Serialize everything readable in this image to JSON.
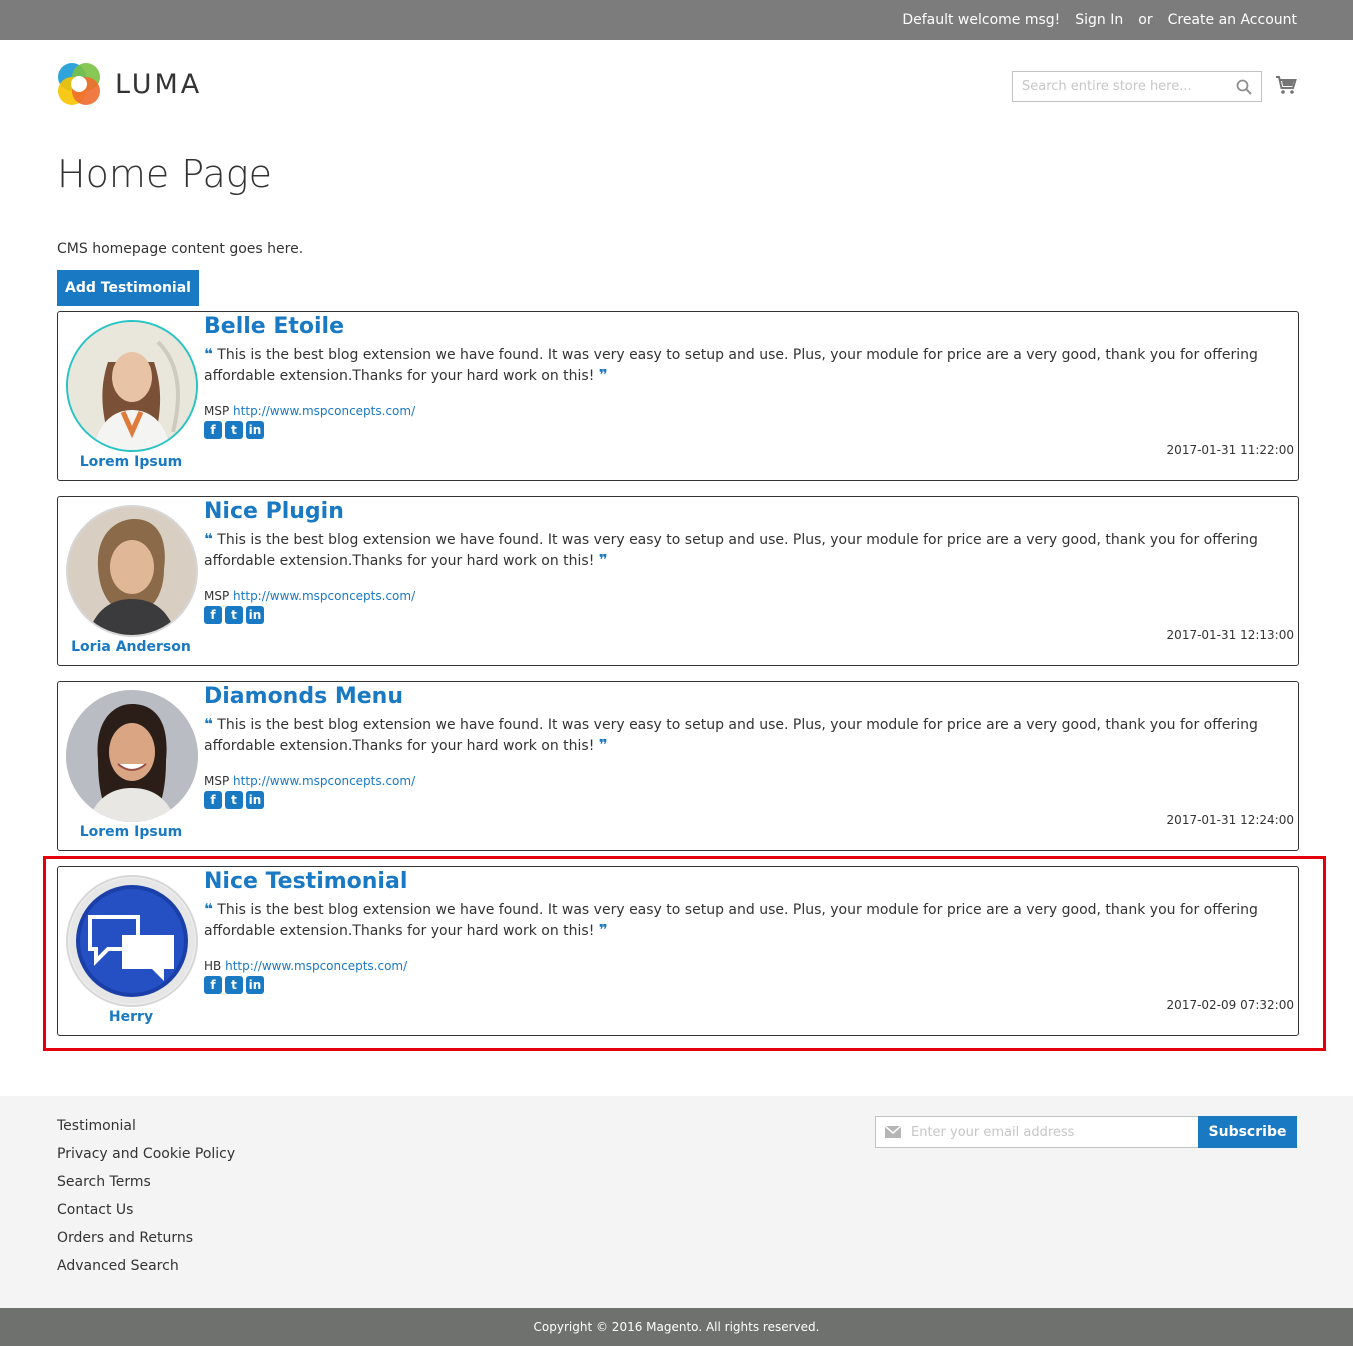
{
  "header": {
    "welcome": "Default welcome msg!",
    "sign_in": "Sign In",
    "or": "or",
    "create_account": "Create an Account",
    "logo_text": "LUMA",
    "search_placeholder": "Search entire store here..."
  },
  "page": {
    "title": "Home Page",
    "cms_text": "CMS homepage content goes here.",
    "add_button": "Add Testimonial"
  },
  "testimonials": [
    {
      "title": "Belle Etoile",
      "body": "This is the best blog extension we have found. It was very easy to setup and use. Plus, your module for price are a very good, thank you for offering affordable extension.Thanks for your hard work on this!",
      "company": "MSP",
      "url": "http://www.mspconcepts.com/",
      "author": "Lorem Ipsum",
      "date": "2017-01-31 11:22:00"
    },
    {
      "title": "Nice Plugin",
      "body": "This is the best blog extension we have found. It was very easy to setup and use. Plus, your module for price are a very good, thank you for offering affordable extension.Thanks for your hard work on this!",
      "company": "MSP",
      "url": "http://www.mspconcepts.com/",
      "author": "Loria Anderson",
      "date": "2017-01-31 12:13:00"
    },
    {
      "title": "Diamonds Menu",
      "body": "This is the best blog extension we have found. It was very easy to setup and use. Plus, your module for price are a very good, thank you for offering affordable extension.Thanks for your hard work on this!",
      "company": "MSP",
      "url": "http://www.mspconcepts.com/",
      "author": "Lorem Ipsum",
      "date": "2017-01-31 12:24:00"
    },
    {
      "title": "Nice Testimonial",
      "body": "This is the best blog extension we have found. It was very easy to setup and use. Plus, your module for price are a very good, thank you for offering affordable extension.Thanks for your hard work on this!",
      "company": "HB",
      "url": "http://www.mspconcepts.com/",
      "author": "Herry",
      "date": "2017-02-09 07:32:00"
    }
  ],
  "footer": {
    "links": [
      "Testimonial",
      "Privacy and Cookie Policy",
      "Search Terms",
      "Contact Us",
      "Orders and Returns",
      "Advanced Search"
    ],
    "email_placeholder": "Enter your email address",
    "subscribe": "Subscribe",
    "copyright": "Copyright © 2016 Magento. All rights reserved."
  },
  "colors": {
    "accent": "#1979c3",
    "topbar": "#7b7c7b",
    "highlight": "#e3000b"
  }
}
